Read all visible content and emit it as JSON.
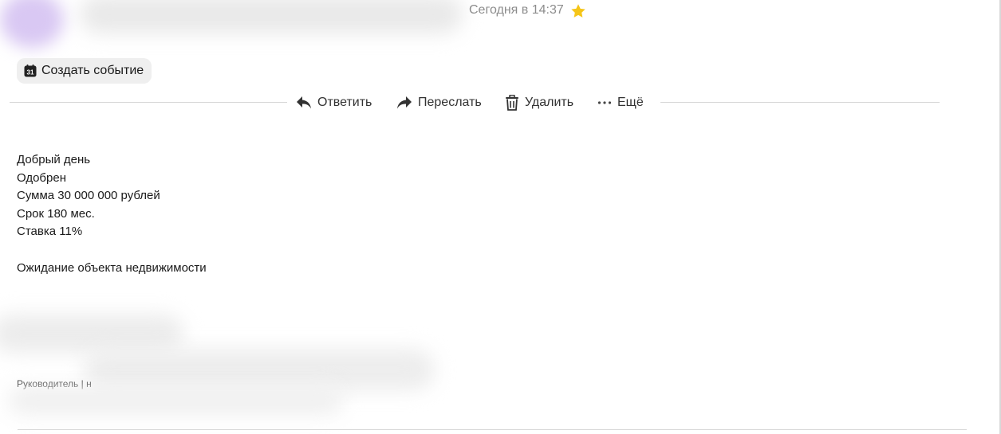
{
  "header": {
    "date": "Сегодня в 14:37",
    "star_icon": "star-icon",
    "star_color": "#f5c518"
  },
  "create_event": {
    "label": "Создать событие",
    "icon": "calendar-icon",
    "icon_text": "31"
  },
  "actions": {
    "reply": "Ответить",
    "forward": "Переслать",
    "delete": "Удалить",
    "more": "Ещё"
  },
  "message": {
    "lines": [
      "Добрый день",
      "Одобрен",
      "Сумма 30 000 000 рублей",
      "Срок 180 мес.",
      "Ставка 11%"
    ],
    "footer_line": "Ожидание объекта недвижимости"
  },
  "signature": {
    "text": "Руководитель | н"
  }
}
